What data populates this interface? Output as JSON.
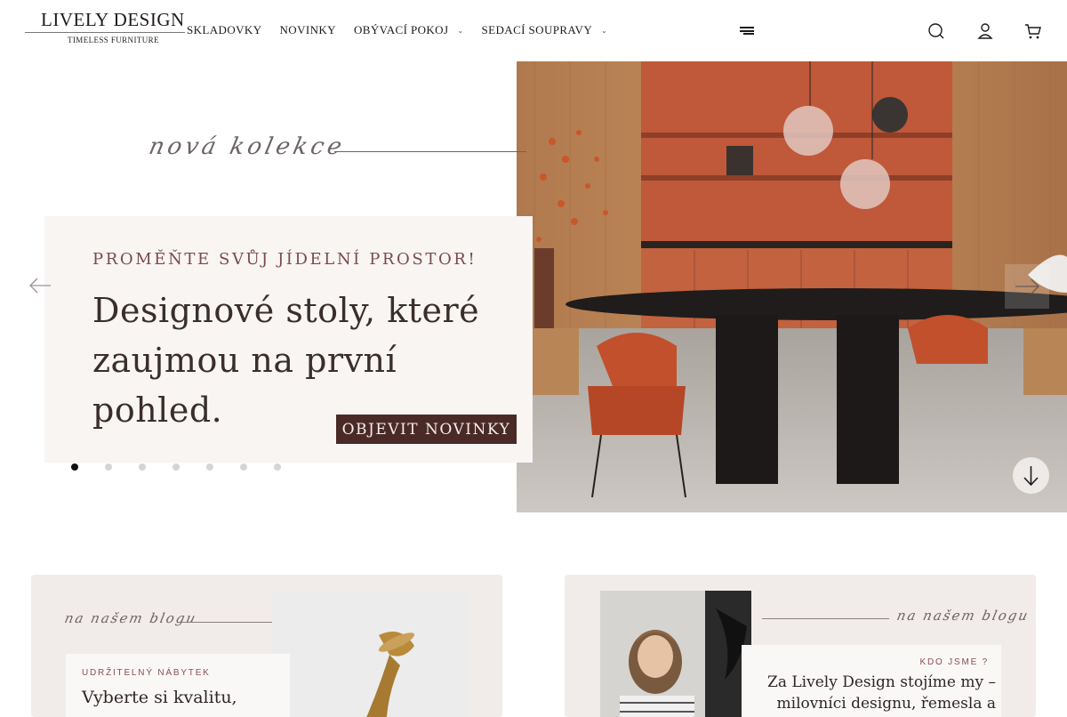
{
  "header": {
    "logo_main": "LIVELY DESIGN",
    "logo_sub": "TIMELESS FURNITURE",
    "nav": [
      {
        "label": "SKLADOVKY",
        "has_dropdown": false
      },
      {
        "label": "NOVINKY",
        "has_dropdown": false
      },
      {
        "label": "OBÝVACÍ POKOJ",
        "has_dropdown": true
      },
      {
        "label": "SEDACÍ SOUPRAVY",
        "has_dropdown": true
      }
    ],
    "icons": [
      "menu-icon",
      "search-icon",
      "user-icon",
      "cart-icon"
    ]
  },
  "hero": {
    "script_heading": "nová kolekce",
    "kicker": "PROMĚŇTE SVŮJ JÍDELNÍ PROSTOR!",
    "title": "Designové stoly, které zaujmou na první pohled.",
    "cta_label": "OBJEVIT NOVINKY",
    "slides_total": 7,
    "active_slide": 1,
    "colors": {
      "card_bg": "#f8f5f3",
      "cta_bg": "#4a2a27",
      "accent_text": "#7a4b4b",
      "wall": "#c0583a"
    }
  },
  "blog": {
    "left": {
      "script_heading": "na našem blogu",
      "kicker": "UDRŽITELNÝ NÁBYTEK",
      "title": "Vyberte si kvalitu,"
    },
    "right": {
      "script_heading": "na našem blogu",
      "kicker": "KDO JSME ?",
      "title_line1": "Za Lively Design stojíme my –",
      "title_line2": "milovníci designu, řemesla a"
    }
  }
}
